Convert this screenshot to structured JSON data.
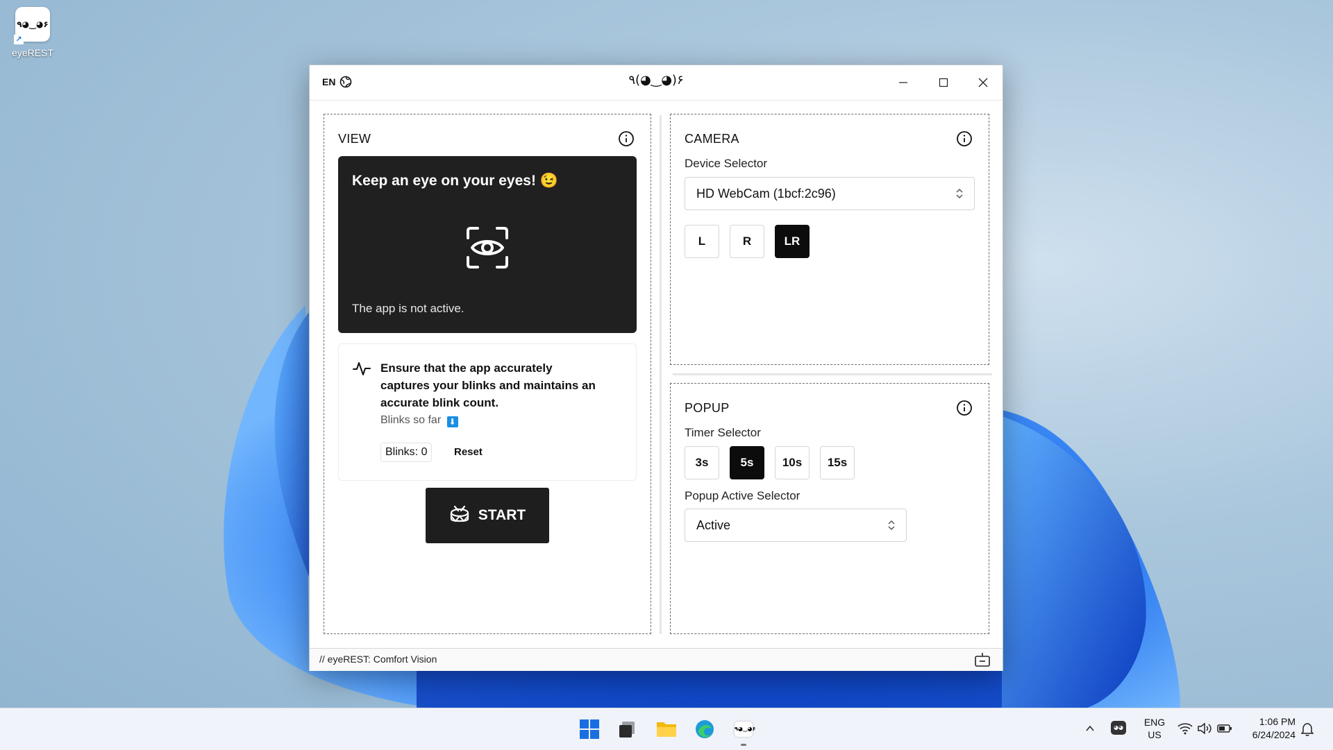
{
  "desktop": {
    "icon_label": "eyeREST",
    "icon_face": "٩◕‿◕۶"
  },
  "window": {
    "lang": "EN",
    "title_face": "٩(◕‿◕)۶",
    "minimize_icon": "minimize-icon",
    "maximize_icon": "maximize-icon",
    "close_icon": "close-icon"
  },
  "view": {
    "title": "VIEW",
    "hero_heading": "Keep an eye on your eyes! 😉",
    "hero_status": "The app is not active.",
    "card_text": "Ensure that the app accurately captures your blinks and maintains an accurate blink count.",
    "blinks_so_far": "Blinks so far",
    "blinks_chip": "Blinks: 0",
    "reset_label": "Reset",
    "start_label": "START"
  },
  "camera": {
    "title": "CAMERA",
    "device_label": "Device Selector",
    "device_value": "HD WebCam (1bcf:2c96)",
    "eye_buttons": [
      "L",
      "R",
      "LR"
    ],
    "selected_eye": "LR"
  },
  "popup": {
    "title": "POPUP",
    "timer_label": "Timer Selector",
    "timer_buttons": [
      "3s",
      "5s",
      "10s",
      "15s"
    ],
    "selected_timer": "5s",
    "active_label": "Popup Active Selector",
    "active_value": "Active"
  },
  "statusbar": {
    "text": "// eyeREST: Comfort Vision"
  },
  "taskbar": {
    "lang_top": "ENG",
    "lang_bottom": "US",
    "time": "1:06 PM",
    "date": "6/24/2024"
  },
  "colors": {
    "accent_dark": "#1e1e1e",
    "hero_bg": "#202020",
    "windows_blue": "#1a5fd6"
  }
}
